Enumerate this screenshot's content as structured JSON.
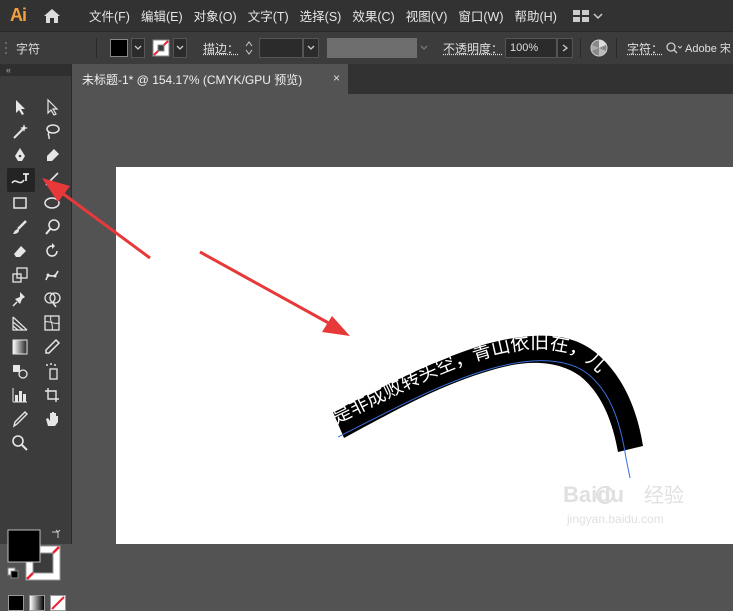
{
  "app": {
    "logo": "Ai",
    "accent": "#f29f3d"
  },
  "menu": [
    "文件(F)",
    "编辑(E)",
    "对象(O)",
    "文字(T)",
    "选择(S)",
    "效果(C)",
    "视图(V)",
    "窗口(W)",
    "帮助(H)"
  ],
  "control": {
    "panel_label": "字符",
    "stroke_label": "描边：",
    "opacity_label": "不透明度：",
    "opacity_value": "100%",
    "char_label": "字符：",
    "font_value": "Adobe 宋"
  },
  "tools_header": "«",
  "document": {
    "tab_title": "未标题-1* @ 154.17% (CMYK/GPU 预览)",
    "close_glyph": "×"
  },
  "artwork": {
    "path_text": "是非成败转头空，青山依旧在，几",
    "band_color": "#000000",
    "text_color": "#ffffff",
    "path_color": "#3b6fd8",
    "arrow_color": "#e8393a"
  },
  "watermark": {
    "logo": "Baidu",
    "cn": "经验",
    "url": "jingyan.baidu.com"
  }
}
